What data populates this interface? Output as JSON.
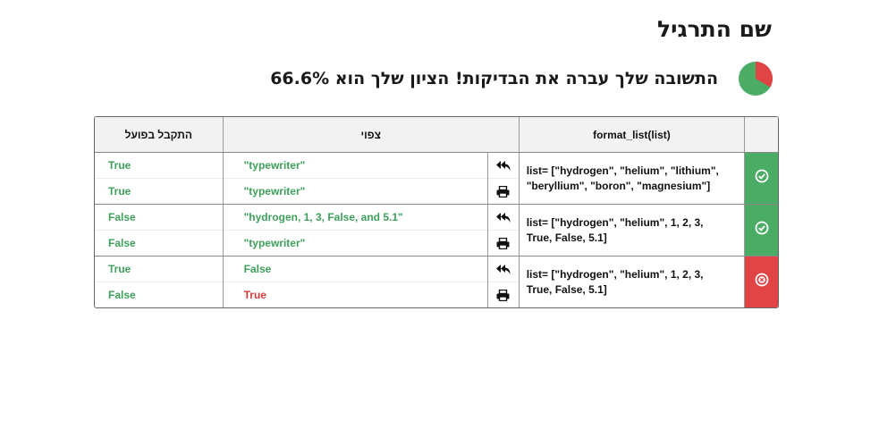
{
  "page": {
    "title": "שם התרגיל",
    "result_text": "התשובה שלך עברה את הבדיקות! הציון שלך הוא 66.6%",
    "score_fraction": 0.666,
    "colors": {
      "pass": "#4aac65",
      "fail": "#e04444"
    }
  },
  "table": {
    "headers": {
      "actual": "התקבל בפועל",
      "expected": "צפוי",
      "function": "format_list(list)",
      "status": ""
    },
    "rows": [
      {
        "status": "pass",
        "status_icon": "check-circle-icon",
        "input": "list= [\"hydrogen\", \"helium\", \"lithium\", \"beryllium\", \"boron\", \"magnesium\"]",
        "subrows": [
          {
            "icon": "reply-all-icon",
            "expected": "\"typewriter\"",
            "expected_color": "green",
            "actual": "True",
            "actual_color": "green"
          },
          {
            "icon": "print-icon",
            "expected": "\"typewriter\"",
            "expected_color": "green",
            "actual": "True",
            "actual_color": "green"
          }
        ]
      },
      {
        "status": "pass",
        "status_icon": "check-circle-icon",
        "input": "list= [\"hydrogen\", \"helium\", 1, 2, 3, True, False, 5.1]",
        "subrows": [
          {
            "icon": "reply-all-icon",
            "expected": "\"hydrogen, 1, 3, False, and 5.1\"",
            "expected_color": "green",
            "actual": "False",
            "actual_color": "green"
          },
          {
            "icon": "print-icon",
            "expected": "\"typewriter\"",
            "expected_color": "green",
            "actual": "False",
            "actual_color": "green"
          }
        ]
      },
      {
        "status": "fail",
        "status_icon": "x-circle-icon",
        "input": "list= [\"hydrogen\", \"helium\", 1, 2, 3, True, False, 5.1]",
        "subrows": [
          {
            "icon": "reply-all-icon",
            "expected": "False",
            "expected_color": "green",
            "actual": "True",
            "actual_color": "green"
          },
          {
            "icon": "print-icon",
            "expected": "True",
            "expected_color": "red",
            "actual": "False",
            "actual_color": "green"
          }
        ]
      }
    ]
  }
}
